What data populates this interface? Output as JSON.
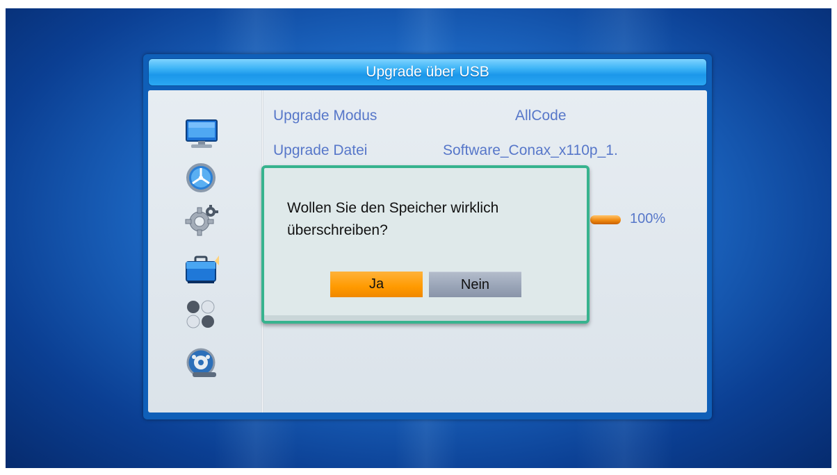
{
  "window": {
    "title": "Upgrade über USB"
  },
  "sidebar": {
    "items": [
      {
        "icon": "tv-monitor-icon"
      },
      {
        "icon": "satellite-dish-icon"
      },
      {
        "icon": "gear-icon"
      },
      {
        "icon": "toolbox-icon",
        "selected": true
      },
      {
        "icon": "games-balls-icon"
      },
      {
        "icon": "media-film-reel-icon"
      }
    ]
  },
  "main": {
    "rows": [
      {
        "label": "Upgrade Modus",
        "value": "AllCode"
      },
      {
        "label": "Upgrade Datei",
        "value": "Software_Conax_x110p_1."
      }
    ],
    "progress": {
      "percent": 100,
      "text": "100%"
    }
  },
  "dialog": {
    "message_line1": "Wollen Sie den Speicher wirklich",
    "message_line2": "überschreiben?",
    "yes_label": "Ja",
    "no_label": "Nein",
    "focused": "yes"
  },
  "colors": {
    "accent_blue": "#1b97ea",
    "text_blue": "#5777c9",
    "dialog_border": "#37b38e",
    "focus_orange": "#ff9a00",
    "button_gray": "#98a3b6"
  }
}
